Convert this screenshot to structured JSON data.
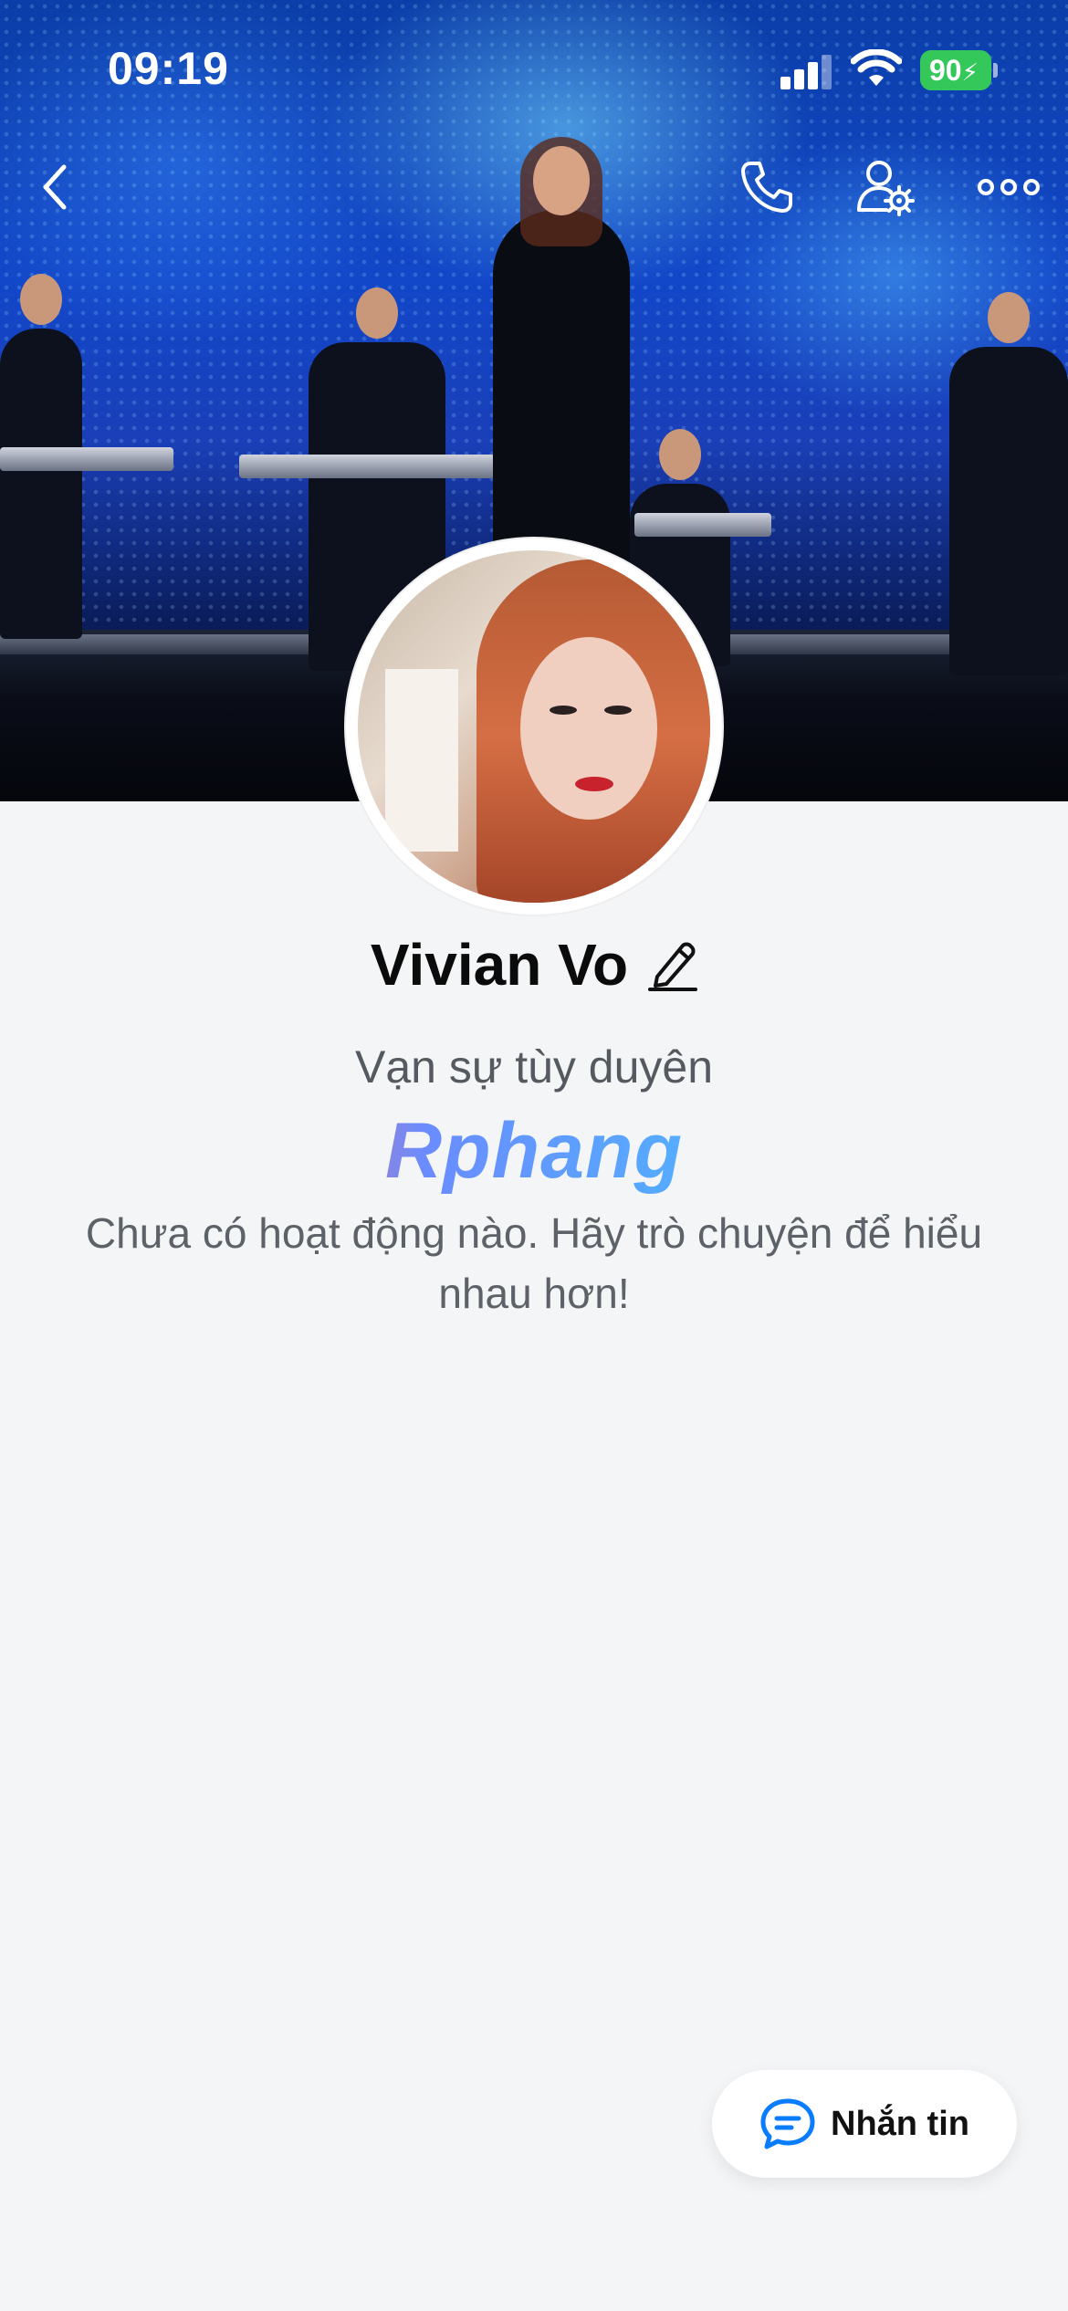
{
  "status_bar": {
    "time": "09:19",
    "battery": "90"
  },
  "nav": {
    "back_icon": "chevron-left-icon",
    "call_icon": "phone-icon",
    "settings_icon": "user-settings-icon",
    "more_icon": "more-horizontal-icon"
  },
  "profile": {
    "name": "Vivian Vo",
    "status": "Vạn sự tùy duyên",
    "brand_watermark": "Rphang",
    "empty_activity": "Chưa có hoạt động nào. Hãy trò chuyện để hiểu nhau hơn!"
  },
  "actions": {
    "message_label": "Nhắn tin",
    "message_icon": "chat-bubble-icon"
  },
  "colors": {
    "background": "#f4f5f7",
    "battery_green": "#34c759",
    "accent_blue": "#0a7cff"
  }
}
